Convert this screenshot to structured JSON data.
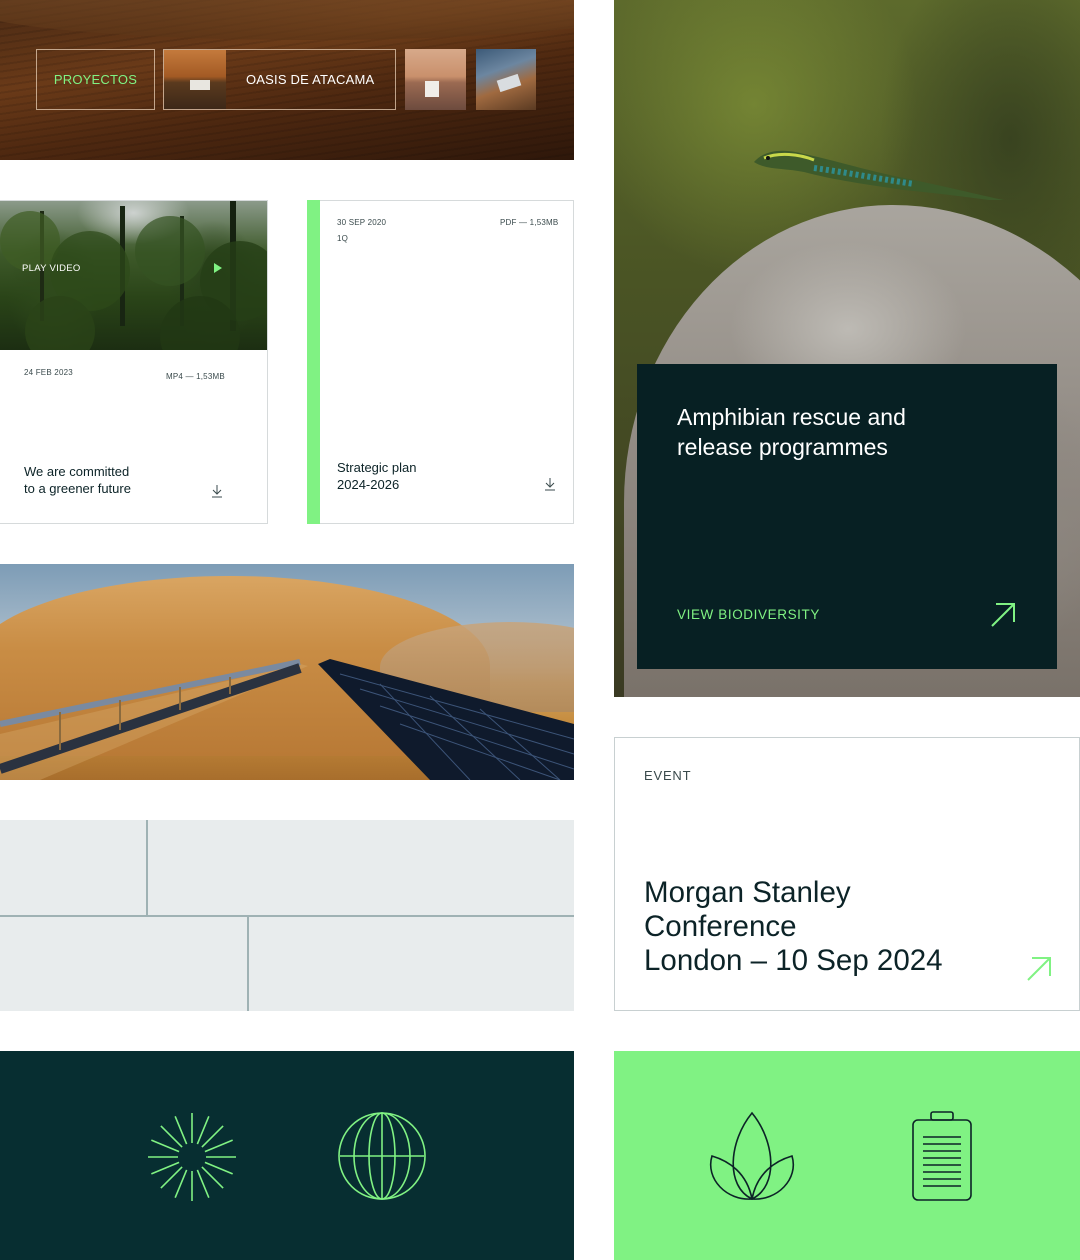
{
  "banner": {
    "proyectos_label": "PROYECTOS",
    "oasis_label": "OASIS DE ATACAMA"
  },
  "video_card": {
    "play_label": "PLAY VIDEO",
    "date": "24 FEB 2023",
    "file_meta": "MP4 — 1,53MB",
    "title_line1": "We are committed",
    "title_line2": "to a greener future"
  },
  "pdf_card": {
    "date": "30 SEP 2020",
    "period": "1Q",
    "file_meta": "PDF — 1,53MB",
    "title_line1": "Strategic plan",
    "title_line2": "2024-2026"
  },
  "biodiversity_card": {
    "title_line1": "Amphibian rescue and",
    "title_line2": "release programmes",
    "link_label": "VIEW BIODIVERSITY"
  },
  "event_card": {
    "tag": "EVENT",
    "title_line1": "Morgan Stanley",
    "title_line2": "Conference",
    "title_line3": "London – 10 Sep 2024"
  },
  "icons": {
    "dark_tile": [
      "sunburst-icon",
      "globe-icon"
    ],
    "green_tile": [
      "lotus-icon",
      "battery-icon"
    ]
  },
  "colors": {
    "accent_green": "#80f283",
    "dark_teal": "#072e31",
    "card_dark": "#072023",
    "text_dark": "#0c2327"
  }
}
